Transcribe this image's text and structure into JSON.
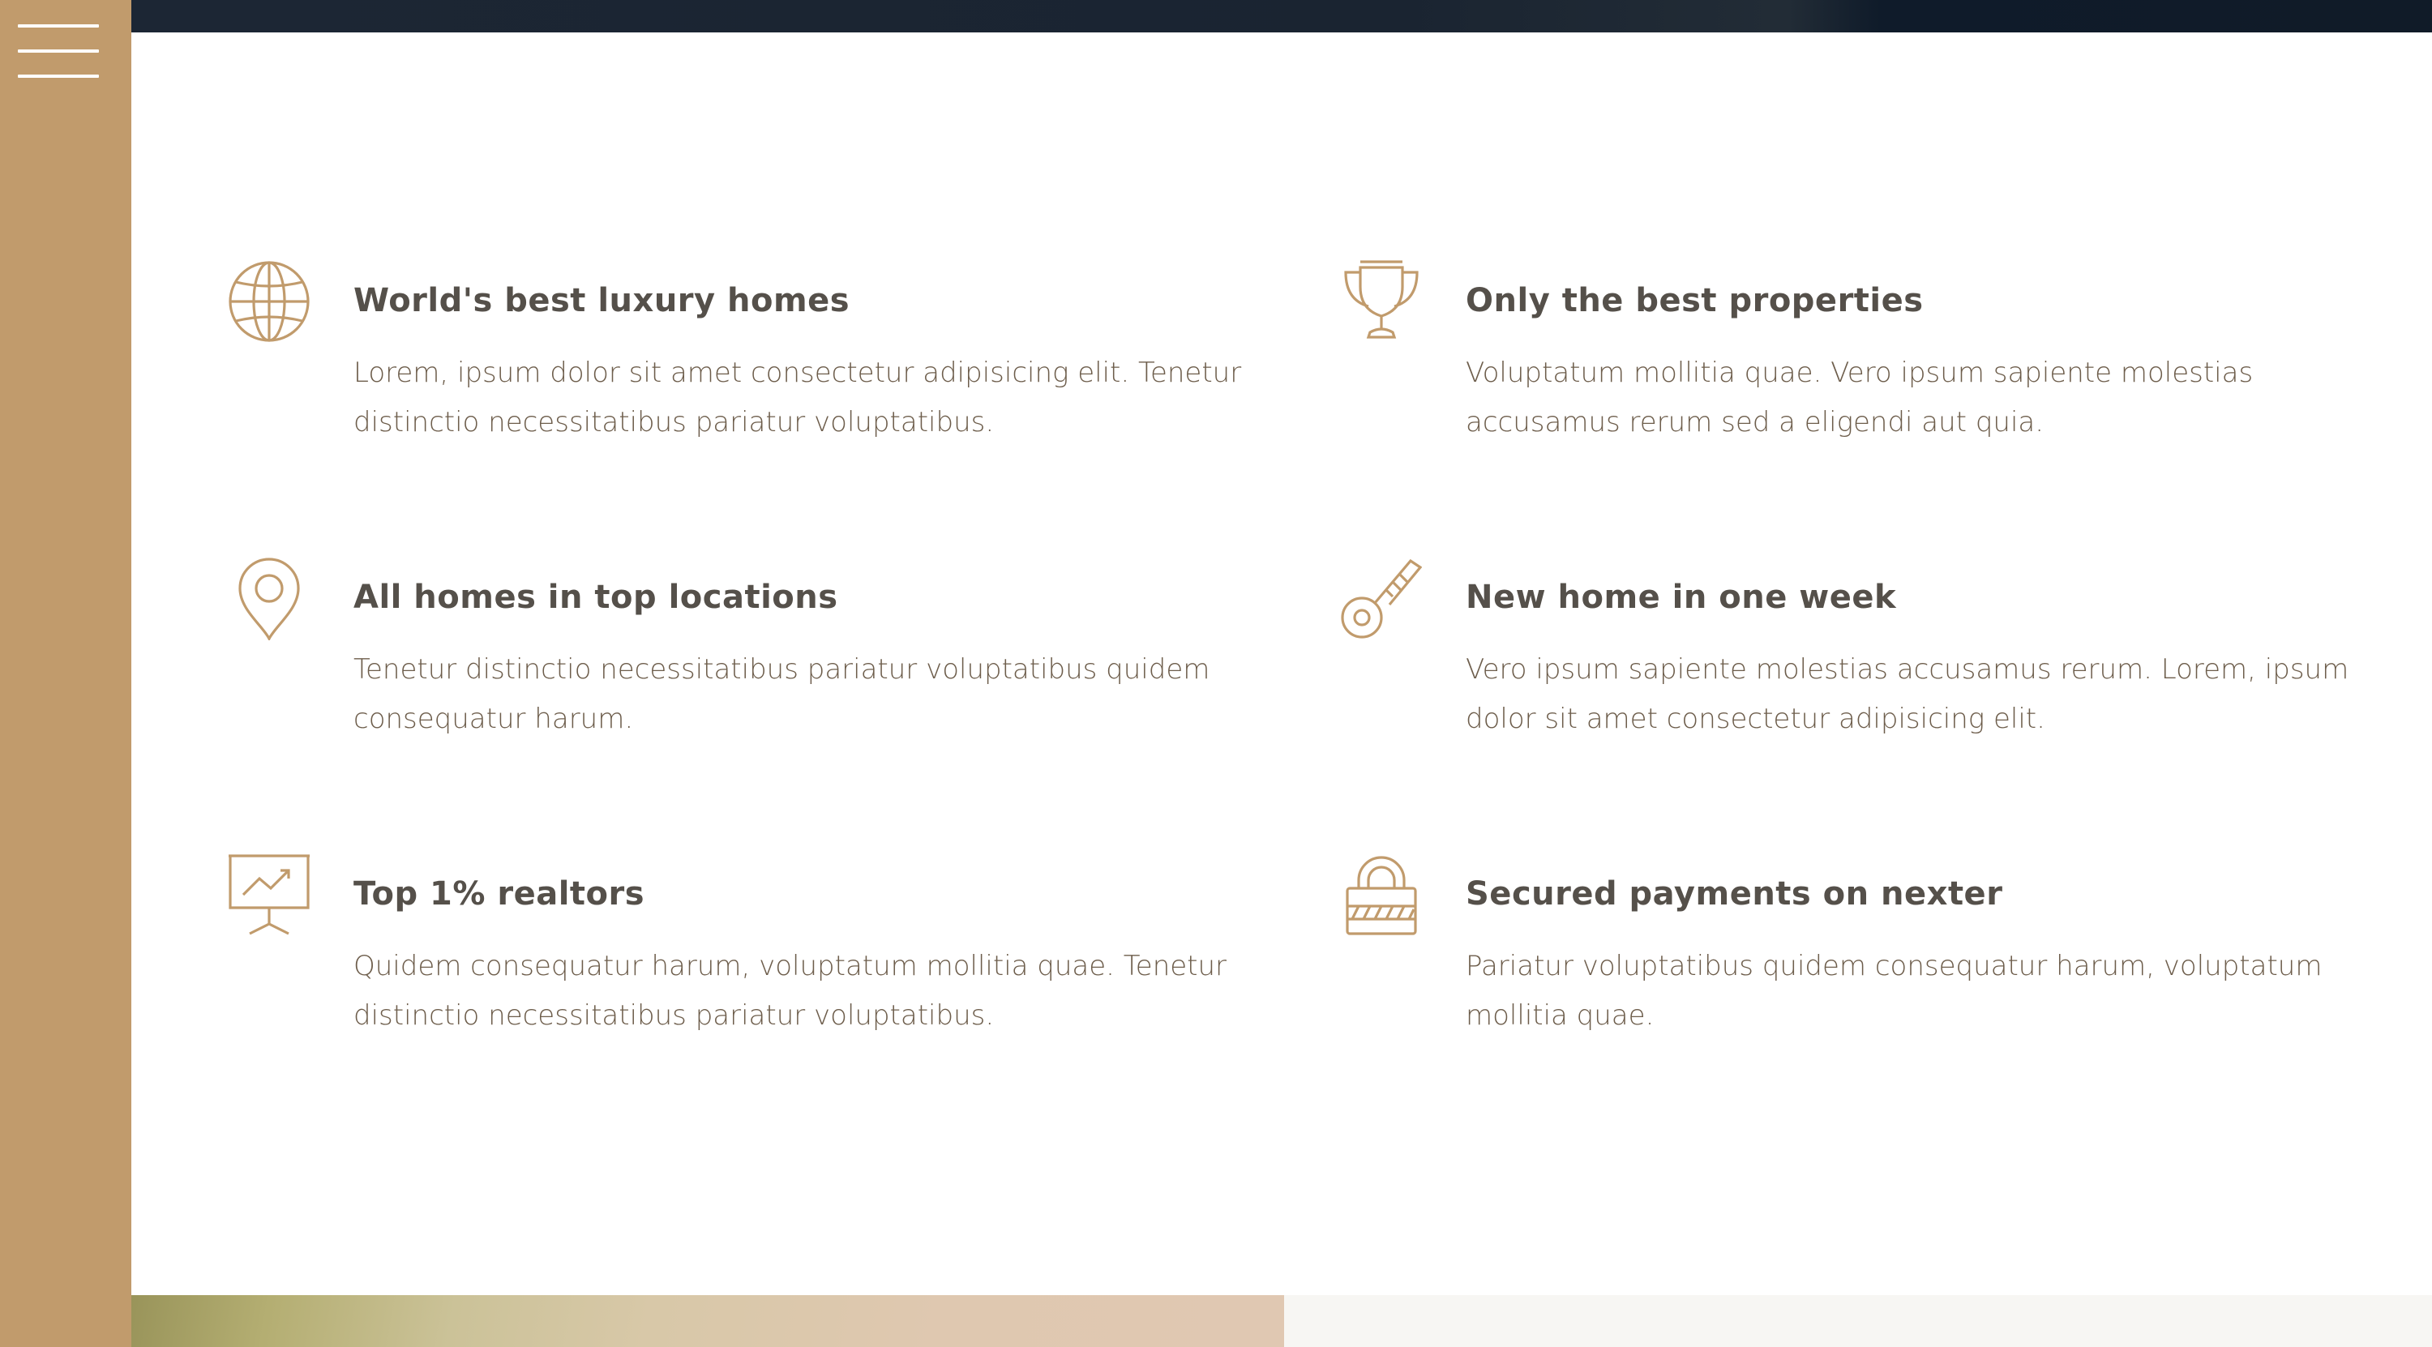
{
  "nav": {
    "menu_icon": "hamburger-menu-icon"
  },
  "colors": {
    "sidebar": "#c19b6c",
    "icon": "#c19b6c",
    "heading": "#55504a",
    "body_text": "#6d5d4b",
    "top_strip": "#1c2634"
  },
  "features": [
    {
      "icon": "globe-icon",
      "title": "World's best luxury homes",
      "text": "Lorem, ipsum dolor sit amet consectetur adipisicing elit. Tenetur distinctio necessitatibus pariatur voluptatibus."
    },
    {
      "icon": "trophy-icon",
      "title": "Only the best properties",
      "text": "Voluptatum mollitia quae. Vero ipsum sapiente molestias accusamus rerum sed a eligendi aut quia."
    },
    {
      "icon": "map-pin-icon",
      "title": "All homes in top locations",
      "text": "Tenetur distinctio necessitatibus pariatur voluptatibus quidem consequatur harum."
    },
    {
      "icon": "key-icon",
      "title": "New home in one week",
      "text": "Vero ipsum sapiente molestias accusamus rerum. Lorem, ipsum dolor sit amet consectetur adipisicing elit."
    },
    {
      "icon": "presentation-chart-icon",
      "title": "Top 1% realtors",
      "text": "Quidem consequatur harum, voluptatum mollitia quae. Tenetur distinctio necessitatibus pariatur voluptatibus."
    },
    {
      "icon": "lock-icon",
      "title": "Secured payments on nexter",
      "text": "Pariatur voluptatibus quidem consequatur harum, voluptatum mollitia quae."
    }
  ]
}
